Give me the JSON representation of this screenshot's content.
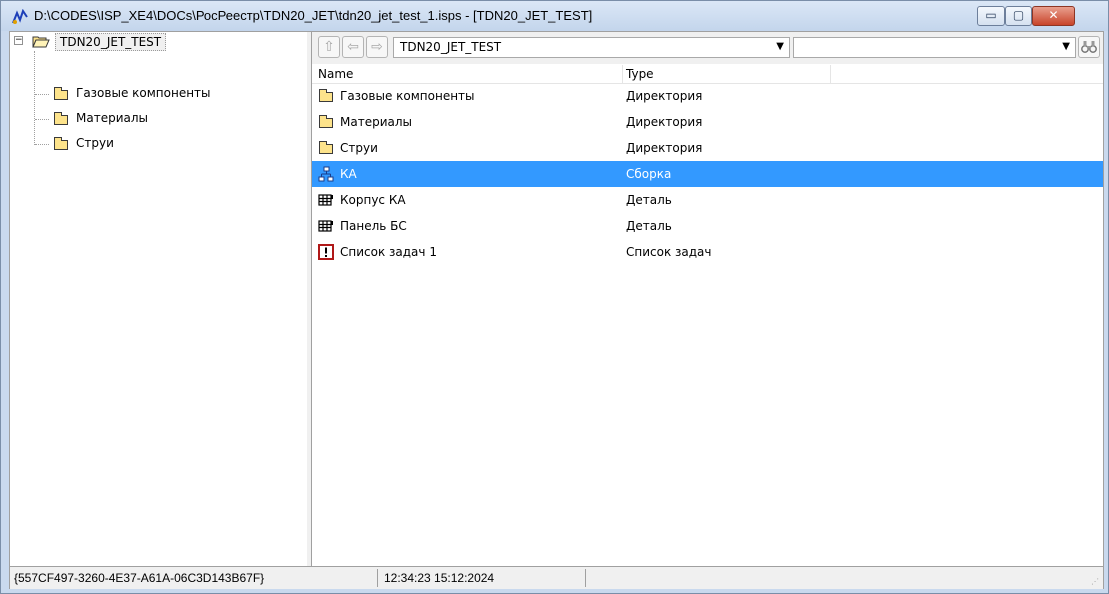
{
  "window": {
    "title": "D:\\CODES\\ISP_XE4\\DOCs\\РосРеестр\\TDN20_JET\\tdn20_jet_test_1.isps - [TDN20_JET_TEST]",
    "app_icon": "app-logo-icon",
    "controls": {
      "minimize": "▭",
      "maximize": "▢",
      "close": "✕"
    }
  },
  "tree": {
    "root": {
      "label": "TDN20_JET_TEST",
      "expander": "−",
      "icon": "open-folder-icon"
    },
    "children": [
      {
        "label": "Газовые компоненты",
        "icon": "folder-icon"
      },
      {
        "label": "Материалы",
        "icon": "folder-icon"
      },
      {
        "label": "Струи",
        "icon": "folder-icon"
      }
    ]
  },
  "toolbar": {
    "up_glyph": "⇧",
    "back_glyph": "⇦",
    "forward_glyph": "⇨",
    "path_value": "TDN20_JET_TEST",
    "search_value": "",
    "find_glyph": "🔍"
  },
  "list": {
    "columns": {
      "name": "Name",
      "type": "Type"
    },
    "rows": [
      {
        "name": "Газовые компоненты",
        "type": "Директория",
        "icon": "folder-icon",
        "selected": false
      },
      {
        "name": "Материалы",
        "type": "Директория",
        "icon": "folder-icon",
        "selected": false
      },
      {
        "name": "Струи",
        "type": "Директория",
        "icon": "folder-icon",
        "selected": false
      },
      {
        "name": "КА",
        "type": "Сборка",
        "icon": "assembly-icon",
        "selected": true
      },
      {
        "name": "Корпус КА",
        "type": "Деталь",
        "icon": "part-icon",
        "selected": false
      },
      {
        "name": "Панель БС",
        "type": "Деталь",
        "icon": "part-icon",
        "selected": false
      },
      {
        "name": "Список задач 1",
        "type": "Список задач",
        "icon": "task-list-icon",
        "selected": false
      }
    ]
  },
  "status": {
    "guid": "{557CF497-3260-4E37-A61A-06C3D143B67F}",
    "timestamp": "12:34:23  15:12:2024",
    "third": ""
  },
  "colors": {
    "selection": "#3399ff",
    "folder": "#fde38b",
    "title_bg": "#c9d9ee",
    "close": "#c8442a"
  }
}
